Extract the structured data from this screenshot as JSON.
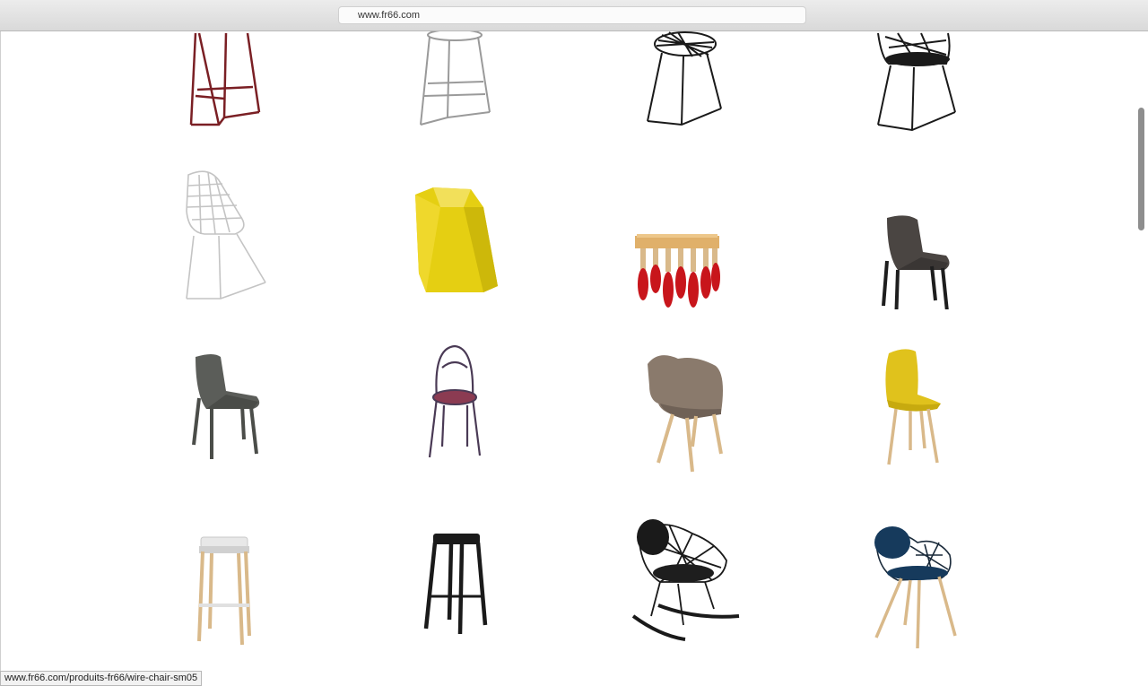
{
  "browser": {
    "url": "www.fr66.com"
  },
  "status_bar": {
    "link": "www.fr66.com/produits-fr66/wire-chair-sm05"
  },
  "products": [
    {
      "name": "burgundy wire bar stool",
      "icon": "bar-stool-wire-burgundy"
    },
    {
      "name": "chrome wire bar stool",
      "icon": "bar-stool-wire-chrome"
    },
    {
      "name": "black wire stool",
      "icon": "wire-stool-black"
    },
    {
      "name": "black wire chair with cushion",
      "icon": "wire-chair-cushion-black"
    },
    {
      "name": "white wire chair",
      "icon": "wire-chair-white"
    },
    {
      "name": "yellow faceted stool",
      "icon": "faceted-stool-yellow"
    },
    {
      "name": "red-dipped leg bench",
      "icon": "dipped-leg-bench-red"
    },
    {
      "name": "dark brown shell chair",
      "icon": "shell-chair-brown"
    },
    {
      "name": "grey plastic chair",
      "icon": "plastic-chair-grey"
    },
    {
      "name": "bentwood bistro chair",
      "icon": "bistro-chair-purple"
    },
    {
      "name": "taupe armchair with wooden legs",
      "icon": "armchair-wood-legs-taupe"
    },
    {
      "name": "yellow chair with wooden legs",
      "icon": "chair-wood-legs-yellow"
    },
    {
      "name": "white and wood bar stool",
      "icon": "bar-stool-white-wood"
    },
    {
      "name": "black bar stool",
      "icon": "bar-stool-black"
    },
    {
      "name": "black wire rocking chair",
      "icon": "wire-rocking-chair-black"
    },
    {
      "name": "navy wire armchair",
      "icon": "wire-armchair-navy"
    }
  ],
  "colors": {
    "burgundy": "#7a1f24",
    "chrome": "#9a9a9a",
    "black": "#1a1a1a",
    "yellow": "#e5cf12",
    "red": "#c8151b",
    "wood": "#d9b98a",
    "navy": "#163a5c"
  }
}
